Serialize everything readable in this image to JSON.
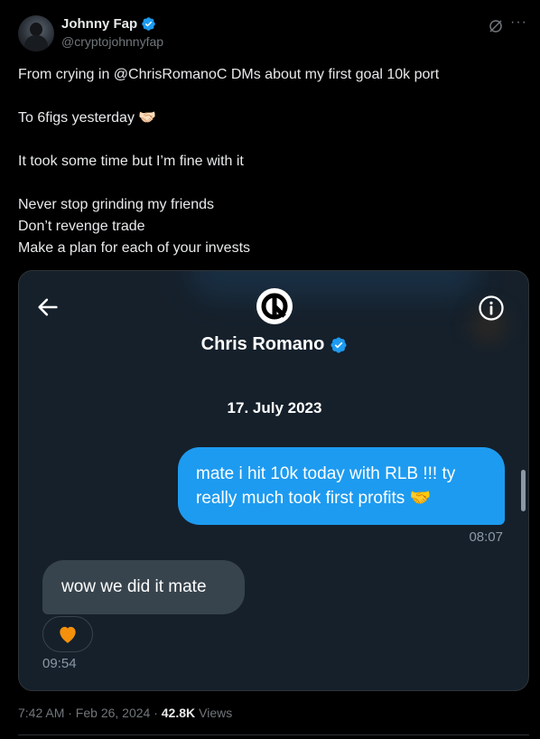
{
  "author": {
    "display_name": "Johnny Fap",
    "handle": "@cryptojohnnyfap"
  },
  "tweet": {
    "lines": [
      "From crying in @ChrisRomanoC DMs about my first goal 10k port",
      "",
      "To 6figs yesterday 🤝🏻",
      "",
      "It took some time but I’m fine with it",
      "",
      "Never stop grinding my friends",
      "Don’t revenge trade",
      "Make a plan for each of your invests"
    ]
  },
  "screenshot": {
    "contact_name": "Chris Romano",
    "date": "17. July 2023",
    "outgoing_message": "mate i hit 10k today with RLB !!! ty really much took first profits 🤝",
    "outgoing_time": "08:07",
    "incoming_message": "wow we did it mate",
    "reaction": "🧡",
    "incoming_time": "09:54"
  },
  "meta": {
    "timestamp": "7:42 AM · Feb 26, 2024 · ",
    "views_count": "42.8K",
    "views_label": "Views"
  },
  "colors": {
    "accent": "#1d9bf0",
    "background": "#000000",
    "dm_background": "#15202b",
    "incoming_bubble": "#38444d"
  }
}
